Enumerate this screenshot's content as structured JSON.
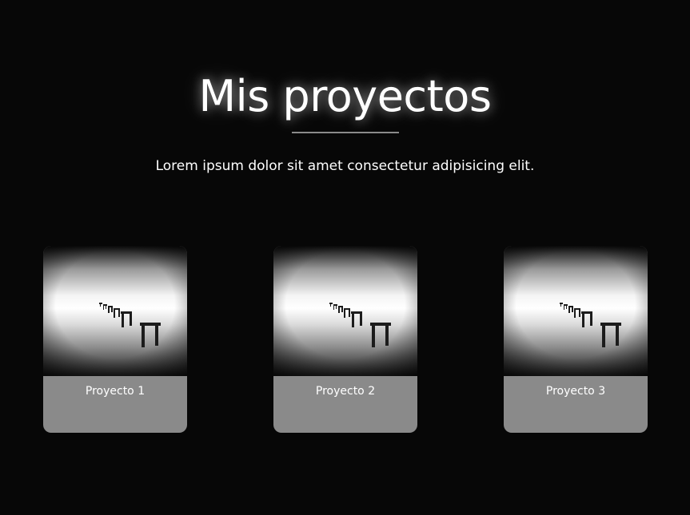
{
  "header": {
    "title": "Mis proyectos",
    "subtitle": "Lorem ipsum dolor sit amet consectetur adipisicing elit."
  },
  "projects": [
    {
      "label": "Proyecto 1",
      "image_icon": "pier-photo"
    },
    {
      "label": "Proyecto 2",
      "image_icon": "pier-photo"
    },
    {
      "label": "Proyecto 3",
      "image_icon": "pier-photo"
    }
  ],
  "colors": {
    "background": "#070707",
    "card": "#8a8a8a",
    "text": "#ffffff",
    "divider": "#8a8a8a"
  }
}
